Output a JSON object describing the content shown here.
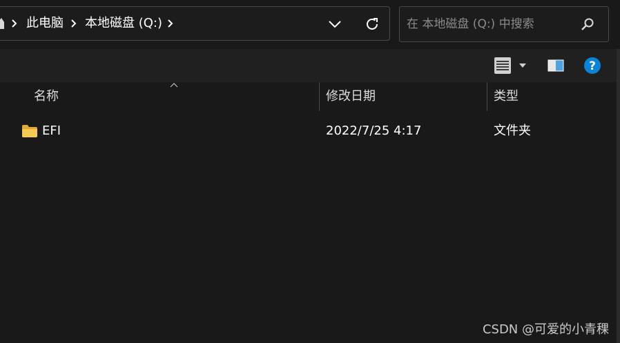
{
  "address_bar": {
    "breadcrumbs": [
      "此电脑",
      "本地磁盘 (Q:)"
    ]
  },
  "search": {
    "placeholder": "在 本地磁盘 (Q:) 中搜索"
  },
  "toolbar": {
    "view_icon": "details-view-icon",
    "pane_icon": "preview-pane-icon",
    "help_icon": "help-icon",
    "help_glyph": "?"
  },
  "columns": {
    "name": "名称",
    "date": "修改日期",
    "type": "类型",
    "sorted_by": "name"
  },
  "rows": [
    {
      "name": "EFI",
      "date": "2022/7/25 4:17",
      "type": "文件夹",
      "icon": "folder-icon"
    }
  ],
  "colors": {
    "background": "#191919",
    "accent": "#0a84d6",
    "folder": "#f1c34f"
  },
  "watermark": "CSDN @可爱的小青稞"
}
